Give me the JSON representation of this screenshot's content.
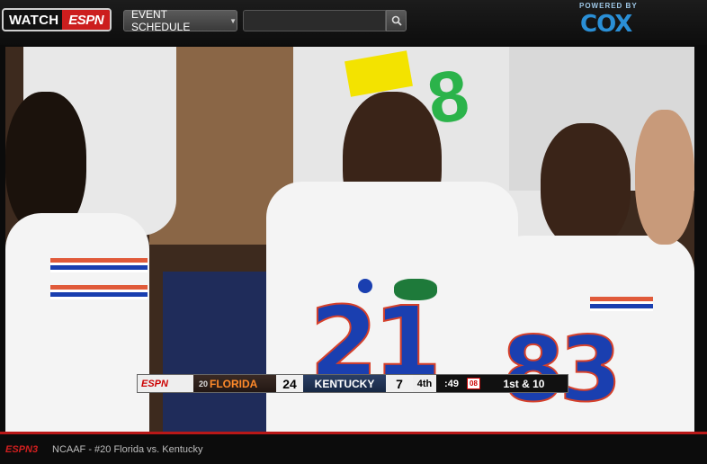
{
  "header": {
    "logo_watch": "WATCH",
    "logo_espn": "ESPN",
    "event_schedule_label": "EVENT SCHEDULE",
    "search_placeholder": "",
    "powered_by": "POWERED BY",
    "sponsor": "COX"
  },
  "video": {
    "jersey_numbers": [
      "21",
      "83"
    ],
    "scorebug": {
      "network": "ESPN",
      "team1_rank": "20",
      "team1_name": "FLORIDA",
      "team1_score": "24",
      "team2_name": "KENTUCKY",
      "team2_score": "7",
      "quarter": "4th",
      "clock": ":49",
      "timeout_badge": "08",
      "down_distance": "1st & 10"
    }
  },
  "footer": {
    "channel": "ESPN3",
    "event_title": "NCAAF - #20 Florida vs. Kentucky"
  },
  "colors": {
    "espn_red": "#cc1e1e",
    "cox_blue": "#2a8fd6",
    "florida_blue": "#1a3fb0",
    "florida_orange": "#ff8a2a"
  }
}
